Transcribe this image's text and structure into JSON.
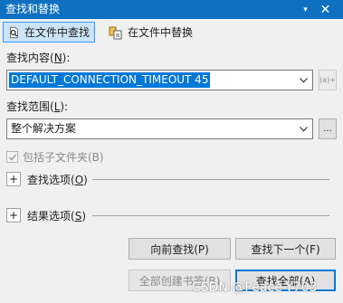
{
  "window": {
    "title": "查找和替换",
    "dropdown_glyph": "▾",
    "close_glyph": "✕"
  },
  "tabs": [
    {
      "label": "在文件中查找",
      "active": true,
      "icon": "find-in-files-icon"
    },
    {
      "label": "在文件中替换",
      "active": false,
      "icon": "replace-in-files-icon"
    }
  ],
  "find": {
    "label_prefix": "查找内容(",
    "label_key": "N",
    "label_suffix": "):",
    "value": "DEFAULT_CONNECTION_TIMEOUT 45",
    "regex_button": "(a)+"
  },
  "scope": {
    "label_prefix": "查找范围(",
    "label_key": "L",
    "label_suffix": "):",
    "value": "整个解决方案",
    "browse_button": "..."
  },
  "include_subfolders": {
    "label": "包括子文件夹(B)",
    "checked": true,
    "enabled": false
  },
  "find_options": {
    "label_prefix": "查找选项(",
    "label_key": "O",
    "label_suffix": ")",
    "expander": "+"
  },
  "result_options": {
    "label_prefix": "结果选项(",
    "label_key": "S",
    "label_suffix": ")",
    "expander": "+"
  },
  "buttons": {
    "find_previous": "向前查找(P)",
    "find_next": "查找下一个(F)",
    "bookmark_all": "全部创建书签(B)",
    "find_all": "查找全部(A)"
  },
  "watermark": "CSDN @Peace-Y703",
  "colors": {
    "titlebar": "#0e70c0",
    "selection": "#0078d7",
    "active_tab": "#cce4f7"
  }
}
